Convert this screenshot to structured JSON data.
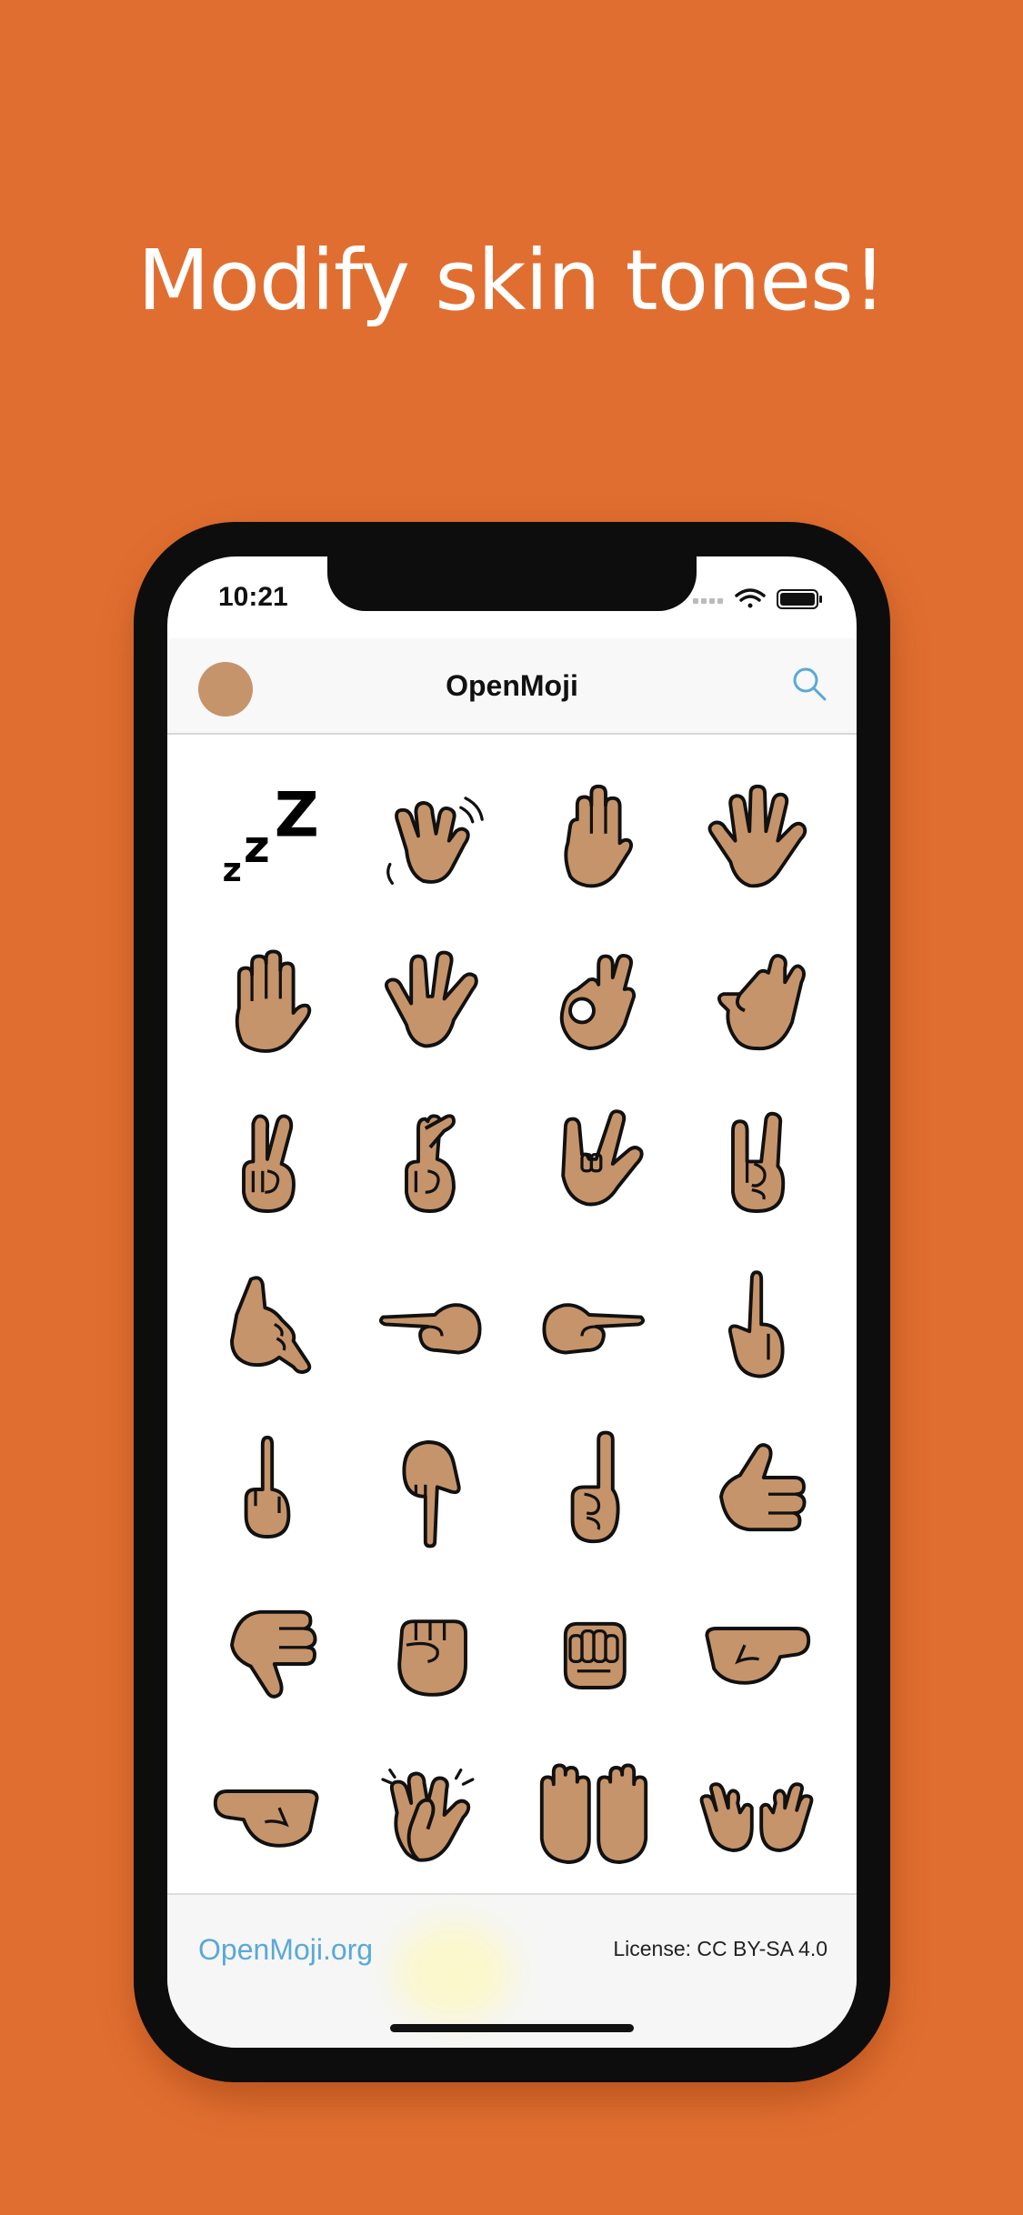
{
  "headline": "Modify skin tones!",
  "status_bar": {
    "time": "10:21"
  },
  "nav": {
    "title": "OpenMoji",
    "skin_tone_color": "#c6946a"
  },
  "grid": {
    "emojis": [
      "zzz",
      "waving-hand",
      "raised-back-of-hand",
      "hand-with-fingers-splayed",
      "raised-hand",
      "vulcan-salute",
      "ok-hand",
      "pinching-hand",
      "victory-hand",
      "crossed-fingers",
      "love-you-gesture",
      "sign-of-the-horns",
      "call-me-hand",
      "backhand-index-pointing-left",
      "backhand-index-pointing-right",
      "backhand-index-pointing-up",
      "middle-finger",
      "backhand-index-pointing-down",
      "index-pointing-up",
      "thumbs-up",
      "thumbs-down",
      "raised-fist",
      "oncoming-fist",
      "left-facing-fist",
      "right-facing-fist",
      "clapping-hands",
      "raising-hands",
      "open-hands"
    ]
  },
  "footer": {
    "link": "OpenMoji.org",
    "license": "License: CC BY-SA 4.0"
  },
  "colors": {
    "background": "#e06e30",
    "skin": "#c6946a",
    "accent": "#5aa9d6"
  }
}
